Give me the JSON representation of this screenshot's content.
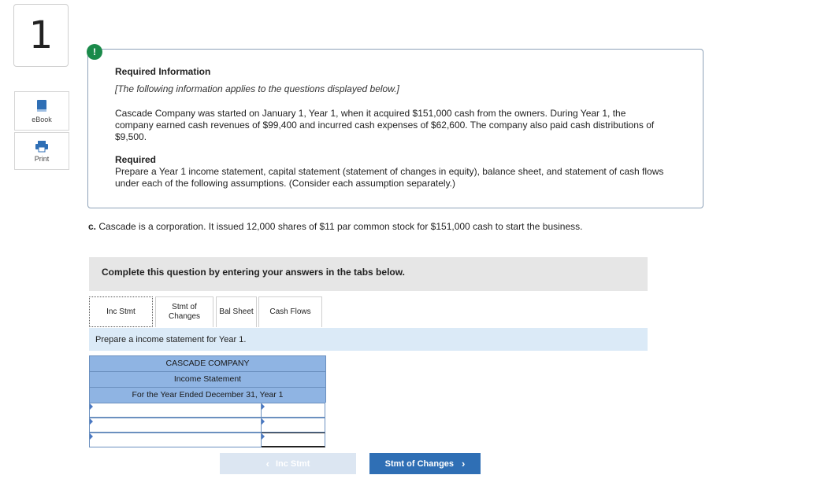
{
  "question_number": "1",
  "tools": {
    "ebook_label": "eBook",
    "print_label": "Print"
  },
  "alert": {
    "symbol": "!"
  },
  "info": {
    "title": "Required Information",
    "italic_note": "[The following information applies to the questions displayed below.]",
    "paragraph": "Cascade Company was started on January 1, Year 1, when it acquired $151,000 cash from the owners. During Year 1, the company earned cash revenues of $99,400 and incurred cash expenses of $62,600. The company also paid cash distributions of $9,500.",
    "required_label": "Required",
    "required_text": "Prepare a Year 1 income statement, capital statement (statement of changes in equity), balance sheet, and statement of cash flows under each of the following assumptions. (Consider each assumption separately.)"
  },
  "part": {
    "letter": "c.",
    "text": " Cascade is a corporation. It issued 12,000 shares of $11 par common stock for $151,000 cash to start the business."
  },
  "banner_text": "Complete this question by entering your answers in the tabs below.",
  "tabs": [
    {
      "label": "Inc Stmt",
      "active": true
    },
    {
      "label": "Stmt of Changes",
      "line1": "Stmt of",
      "line2": "Changes",
      "active": false
    },
    {
      "label": "Bal Sheet",
      "active": false
    },
    {
      "label": "Cash Flows",
      "active": false
    }
  ],
  "prompt": "Prepare a income statement for Year 1.",
  "statement": {
    "company": "CASCADE COMPANY",
    "title": "Income Statement",
    "period": "For the Year Ended December 31, Year 1",
    "rows": [
      {
        "label": "",
        "value": ""
      },
      {
        "label": "",
        "value": ""
      },
      {
        "label": "",
        "value": ""
      }
    ]
  },
  "nav": {
    "prev_label": "Inc Stmt",
    "next_label": "Stmt of Changes"
  },
  "colors": {
    "accent": "#2f6fb5",
    "header_blue": "#8fb4e3",
    "prompt_bg": "#dbeaf7",
    "alert_green": "#1a8a4a"
  }
}
